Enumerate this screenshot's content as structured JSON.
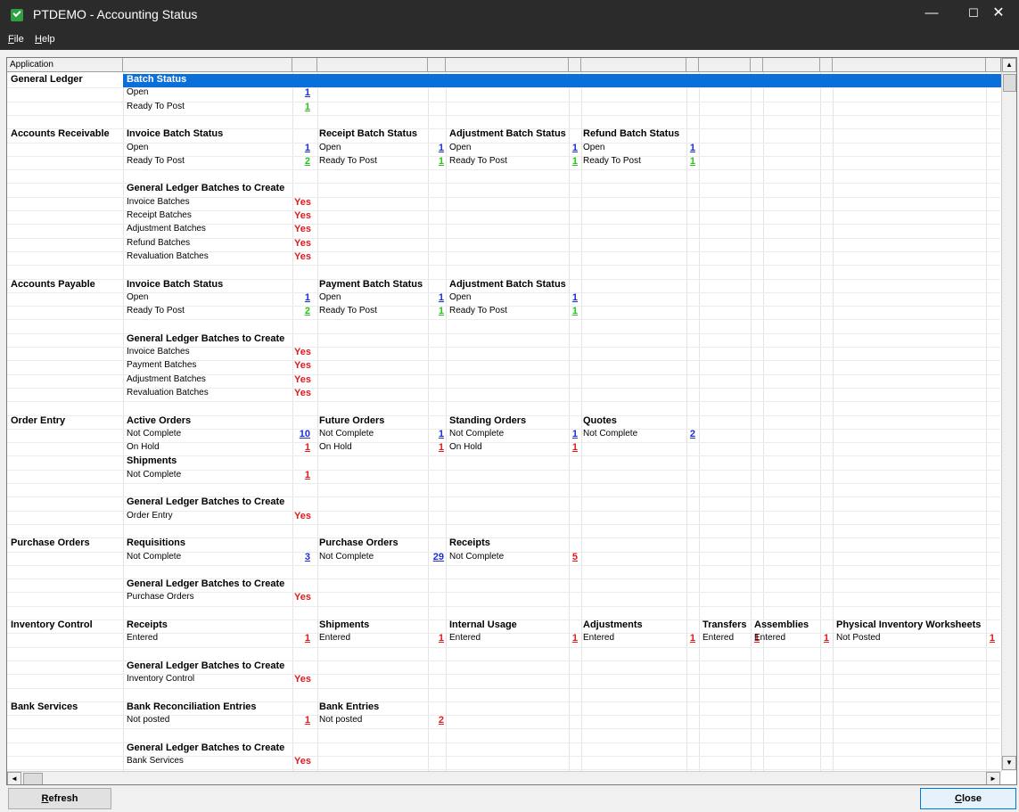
{
  "window": {
    "title": "PTDEMO - Accounting Status",
    "min": "—",
    "max": "☐",
    "close": "✕"
  },
  "menu": {
    "file_rest": "ile",
    "file_u": "F",
    "help_u": "H",
    "help_rest": "elp"
  },
  "grid": {
    "column_header": "Application",
    "selected_label": "Batch Status",
    "scroll_up": "▲",
    "scroll_down": "▼",
    "scroll_left": "◄",
    "scroll_right": "►"
  },
  "rows": [
    {
      "col": "app",
      "row": 0,
      "text": "General Ledger",
      "cls": "app"
    },
    {
      "col": "c1",
      "row": 1,
      "text": "Open",
      "cls": "txt"
    },
    {
      "col": "n1",
      "row": 1,
      "text": "1",
      "cls": "num blue"
    },
    {
      "col": "c1",
      "row": 2,
      "text": "Ready To Post",
      "cls": "txt"
    },
    {
      "col": "n1",
      "row": 2,
      "text": "1",
      "cls": "num green"
    },
    {
      "col": "app",
      "row": 4,
      "text": "Accounts Receivable",
      "cls": "app"
    },
    {
      "col": "c1",
      "row": 4,
      "text": "Invoice Batch Status",
      "cls": "hdr"
    },
    {
      "col": "c2",
      "row": 4,
      "text": "Receipt Batch Status",
      "cls": "hdr"
    },
    {
      "col": "c3",
      "row": 4,
      "text": "Adjustment Batch Status",
      "cls": "hdr"
    },
    {
      "col": "c4",
      "row": 4,
      "text": "Refund Batch Status",
      "cls": "hdr"
    },
    {
      "col": "c1",
      "row": 5,
      "text": "Open",
      "cls": "txt"
    },
    {
      "col": "n1",
      "row": 5,
      "text": "1",
      "cls": "num blue"
    },
    {
      "col": "c2",
      "row": 5,
      "text": "Open",
      "cls": "txt"
    },
    {
      "col": "n2",
      "row": 5,
      "text": "1",
      "cls": "num blue"
    },
    {
      "col": "c3",
      "row": 5,
      "text": "Open",
      "cls": "txt"
    },
    {
      "col": "n3",
      "row": 5,
      "text": "1",
      "cls": "num blue"
    },
    {
      "col": "c4",
      "row": 5,
      "text": "Open",
      "cls": "txt"
    },
    {
      "col": "n4",
      "row": 5,
      "text": "1",
      "cls": "num blue"
    },
    {
      "col": "c1",
      "row": 6,
      "text": "Ready To Post",
      "cls": "txt"
    },
    {
      "col": "n1",
      "row": 6,
      "text": "2",
      "cls": "num green"
    },
    {
      "col": "c2",
      "row": 6,
      "text": "Ready To Post",
      "cls": "txt"
    },
    {
      "col": "n2",
      "row": 6,
      "text": "1",
      "cls": "num green"
    },
    {
      "col": "c3",
      "row": 6,
      "text": "Ready To Post",
      "cls": "txt"
    },
    {
      "col": "n3",
      "row": 6,
      "text": "1",
      "cls": "num green"
    },
    {
      "col": "c4",
      "row": 6,
      "text": "Ready To Post",
      "cls": "txt"
    },
    {
      "col": "n4",
      "row": 6,
      "text": "1",
      "cls": "num green"
    },
    {
      "col": "c1",
      "row": 8,
      "text": "General Ledger Batches to Create",
      "cls": "hdr"
    },
    {
      "col": "c1",
      "row": 9,
      "text": "Invoice Batches",
      "cls": "txt"
    },
    {
      "col": "y1",
      "row": 9,
      "text": "Yes",
      "cls": "yes"
    },
    {
      "col": "c1",
      "row": 10,
      "text": "Receipt Batches",
      "cls": "txt"
    },
    {
      "col": "y1",
      "row": 10,
      "text": "Yes",
      "cls": "yes"
    },
    {
      "col": "c1",
      "row": 11,
      "text": "Adjustment Batches",
      "cls": "txt"
    },
    {
      "col": "y1",
      "row": 11,
      "text": "Yes",
      "cls": "yes"
    },
    {
      "col": "c1",
      "row": 12,
      "text": "Refund Batches",
      "cls": "txt"
    },
    {
      "col": "y1",
      "row": 12,
      "text": "Yes",
      "cls": "yes"
    },
    {
      "col": "c1",
      "row": 13,
      "text": "Revaluation Batches",
      "cls": "txt"
    },
    {
      "col": "y1",
      "row": 13,
      "text": "Yes",
      "cls": "yes"
    },
    {
      "col": "app",
      "row": 15,
      "text": "Accounts Payable",
      "cls": "app"
    },
    {
      "col": "c1",
      "row": 15,
      "text": "Invoice Batch Status",
      "cls": "hdr"
    },
    {
      "col": "c2",
      "row": 15,
      "text": "Payment Batch Status",
      "cls": "hdr"
    },
    {
      "col": "c3",
      "row": 15,
      "text": "Adjustment Batch Status",
      "cls": "hdr"
    },
    {
      "col": "c1",
      "row": 16,
      "text": "Open",
      "cls": "txt"
    },
    {
      "col": "n1",
      "row": 16,
      "text": "1",
      "cls": "num blue"
    },
    {
      "col": "c2",
      "row": 16,
      "text": "Open",
      "cls": "txt"
    },
    {
      "col": "n2",
      "row": 16,
      "text": "1",
      "cls": "num blue"
    },
    {
      "col": "c3",
      "row": 16,
      "text": "Open",
      "cls": "txt"
    },
    {
      "col": "n3",
      "row": 16,
      "text": "1",
      "cls": "num blue"
    },
    {
      "col": "c1",
      "row": 17,
      "text": "Ready To Post",
      "cls": "txt"
    },
    {
      "col": "n1",
      "row": 17,
      "text": "2",
      "cls": "num green"
    },
    {
      "col": "c2",
      "row": 17,
      "text": "Ready To Post",
      "cls": "txt"
    },
    {
      "col": "n2",
      "row": 17,
      "text": "1",
      "cls": "num green"
    },
    {
      "col": "c3",
      "row": 17,
      "text": "Ready To Post",
      "cls": "txt"
    },
    {
      "col": "n3",
      "row": 17,
      "text": "1",
      "cls": "num green"
    },
    {
      "col": "c1",
      "row": 19,
      "text": "General Ledger Batches to Create",
      "cls": "hdr"
    },
    {
      "col": "c1",
      "row": 20,
      "text": "Invoice Batches",
      "cls": "txt"
    },
    {
      "col": "y1",
      "row": 20,
      "text": "Yes",
      "cls": "yes"
    },
    {
      "col": "c1",
      "row": 21,
      "text": "Payment Batches",
      "cls": "txt"
    },
    {
      "col": "y1",
      "row": 21,
      "text": "Yes",
      "cls": "yes"
    },
    {
      "col": "c1",
      "row": 22,
      "text": "Adjustment Batches",
      "cls": "txt"
    },
    {
      "col": "y1",
      "row": 22,
      "text": "Yes",
      "cls": "yes"
    },
    {
      "col": "c1",
      "row": 23,
      "text": "Revaluation Batches",
      "cls": "txt"
    },
    {
      "col": "y1",
      "row": 23,
      "text": "Yes",
      "cls": "yes"
    },
    {
      "col": "app",
      "row": 25,
      "text": "Order Entry",
      "cls": "app"
    },
    {
      "col": "c1",
      "row": 25,
      "text": "Active Orders",
      "cls": "hdr"
    },
    {
      "col": "c2",
      "row": 25,
      "text": "Future Orders",
      "cls": "hdr"
    },
    {
      "col": "c3",
      "row": 25,
      "text": "Standing Orders",
      "cls": "hdr"
    },
    {
      "col": "c4",
      "row": 25,
      "text": "Quotes",
      "cls": "hdr"
    },
    {
      "col": "c1",
      "row": 26,
      "text": "Not Complete",
      "cls": "txt"
    },
    {
      "col": "n1",
      "row": 26,
      "text": "10",
      "cls": "num blue"
    },
    {
      "col": "c2",
      "row": 26,
      "text": "Not Complete",
      "cls": "txt"
    },
    {
      "col": "n2",
      "row": 26,
      "text": "1",
      "cls": "num blue"
    },
    {
      "col": "c3",
      "row": 26,
      "text": "Not Complete",
      "cls": "txt"
    },
    {
      "col": "n3",
      "row": 26,
      "text": "1",
      "cls": "num blue"
    },
    {
      "col": "c4",
      "row": 26,
      "text": "Not Complete",
      "cls": "txt"
    },
    {
      "col": "n4",
      "row": 26,
      "text": "2",
      "cls": "num blue"
    },
    {
      "col": "c1",
      "row": 27,
      "text": "On Hold",
      "cls": "txt"
    },
    {
      "col": "n1",
      "row": 27,
      "text": "1",
      "cls": "num red"
    },
    {
      "col": "c2",
      "row": 27,
      "text": "On Hold",
      "cls": "txt"
    },
    {
      "col": "n2",
      "row": 27,
      "text": "1",
      "cls": "num red"
    },
    {
      "col": "c3",
      "row": 27,
      "text": "On Hold",
      "cls": "txt"
    },
    {
      "col": "n3",
      "row": 27,
      "text": "1",
      "cls": "num red"
    },
    {
      "col": "c1",
      "row": 28,
      "text": "Shipments",
      "cls": "hdr"
    },
    {
      "col": "c1",
      "row": 29,
      "text": "Not Complete",
      "cls": "txt"
    },
    {
      "col": "n1",
      "row": 29,
      "text": "1",
      "cls": "num red"
    },
    {
      "col": "c1",
      "row": 31,
      "text": "General Ledger Batches to Create",
      "cls": "hdr"
    },
    {
      "col": "c1",
      "row": 32,
      "text": "Order Entry",
      "cls": "txt"
    },
    {
      "col": "y1",
      "row": 32,
      "text": "Yes",
      "cls": "yes"
    },
    {
      "col": "app",
      "row": 34,
      "text": "Purchase Orders",
      "cls": "app"
    },
    {
      "col": "c1",
      "row": 34,
      "text": "Requisitions",
      "cls": "hdr"
    },
    {
      "col": "c2",
      "row": 34,
      "text": "Purchase Orders",
      "cls": "hdr"
    },
    {
      "col": "c3",
      "row": 34,
      "text": "Receipts",
      "cls": "hdr"
    },
    {
      "col": "c1",
      "row": 35,
      "text": "Not Complete",
      "cls": "txt"
    },
    {
      "col": "n1",
      "row": 35,
      "text": "3",
      "cls": "num blue"
    },
    {
      "col": "c2",
      "row": 35,
      "text": "Not Complete",
      "cls": "txt"
    },
    {
      "col": "n2",
      "row": 35,
      "text": "29",
      "cls": "num blue"
    },
    {
      "col": "c3",
      "row": 35,
      "text": "Not Complete",
      "cls": "txt"
    },
    {
      "col": "n3",
      "row": 35,
      "text": "5",
      "cls": "num red"
    },
    {
      "col": "c1",
      "row": 37,
      "text": "General Ledger Batches to Create",
      "cls": "hdr"
    },
    {
      "col": "c1",
      "row": 38,
      "text": "Purchase Orders",
      "cls": "txt"
    },
    {
      "col": "y1",
      "row": 38,
      "text": "Yes",
      "cls": "yes"
    },
    {
      "col": "app",
      "row": 40,
      "text": "Inventory Control",
      "cls": "app"
    },
    {
      "col": "c1",
      "row": 40,
      "text": "Receipts",
      "cls": "hdr"
    },
    {
      "col": "c2",
      "row": 40,
      "text": "Shipments",
      "cls": "hdr"
    },
    {
      "col": "c3",
      "row": 40,
      "text": "Internal Usage",
      "cls": "hdr"
    },
    {
      "col": "c4",
      "row": 40,
      "text": "Adjustments",
      "cls": "hdr"
    },
    {
      "col": "c5",
      "row": 40,
      "text": "Transfers",
      "cls": "hdr"
    },
    {
      "col": "c6",
      "row": 40,
      "text": "Assemblies",
      "cls": "hdr"
    },
    {
      "col": "c7",
      "row": 40,
      "text": "Physical Inventory Worksheets",
      "cls": "hdr"
    },
    {
      "col": "c1",
      "row": 41,
      "text": "Entered",
      "cls": "txt"
    },
    {
      "col": "n1",
      "row": 41,
      "text": "1",
      "cls": "num red"
    },
    {
      "col": "c2",
      "row": 41,
      "text": "Entered",
      "cls": "txt"
    },
    {
      "col": "n2",
      "row": 41,
      "text": "1",
      "cls": "num red"
    },
    {
      "col": "c3",
      "row": 41,
      "text": "Entered",
      "cls": "txt"
    },
    {
      "col": "n3",
      "row": 41,
      "text": "1",
      "cls": "num red"
    },
    {
      "col": "c4",
      "row": 41,
      "text": "Entered",
      "cls": "txt"
    },
    {
      "col": "n4",
      "row": 41,
      "text": "1",
      "cls": "num red"
    },
    {
      "col": "c5",
      "row": 41,
      "text": "Entered",
      "cls": "txt"
    },
    {
      "col": "n5",
      "row": 41,
      "text": "1",
      "cls": "num red"
    },
    {
      "col": "c6",
      "row": 41,
      "text": "Entered",
      "cls": "txt"
    },
    {
      "col": "n6",
      "row": 41,
      "text": "1",
      "cls": "num red"
    },
    {
      "col": "c7",
      "row": 41,
      "text": "Not Posted",
      "cls": "txt"
    },
    {
      "col": "n7",
      "row": 41,
      "text": "1",
      "cls": "num red"
    },
    {
      "col": "c1",
      "row": 43,
      "text": "General Ledger Batches to Create",
      "cls": "hdr"
    },
    {
      "col": "c1",
      "row": 44,
      "text": "Inventory Control",
      "cls": "txt"
    },
    {
      "col": "y1",
      "row": 44,
      "text": "Yes",
      "cls": "yes"
    },
    {
      "col": "app",
      "row": 46,
      "text": "Bank Services",
      "cls": "app"
    },
    {
      "col": "c1",
      "row": 46,
      "text": "Bank Reconciliation Entries",
      "cls": "hdr"
    },
    {
      "col": "c2",
      "row": 46,
      "text": "Bank Entries",
      "cls": "hdr"
    },
    {
      "col": "c1",
      "row": 47,
      "text": "Not posted",
      "cls": "txt"
    },
    {
      "col": "n1",
      "row": 47,
      "text": "1",
      "cls": "num red"
    },
    {
      "col": "c2",
      "row": 47,
      "text": "Not posted",
      "cls": "txt"
    },
    {
      "col": "n2",
      "row": 47,
      "text": "2",
      "cls": "num red"
    },
    {
      "col": "c1",
      "row": 49,
      "text": "General Ledger Batches to Create",
      "cls": "hdr"
    },
    {
      "col": "c1",
      "row": 50,
      "text": "Bank Services",
      "cls": "txt"
    },
    {
      "col": "y1",
      "row": 50,
      "text": "Yes",
      "cls": "yes"
    }
  ],
  "buttons": {
    "refresh_u": "R",
    "refresh_rest": "efresh",
    "close_u": "C",
    "close_rest": "lose"
  },
  "colors": {
    "titlebar": "#2b2b2b",
    "selection": "#0a6fd8",
    "link_blue": "#1a2fd6",
    "ready_green": "#27c41e",
    "alert_red": "#e01b1b"
  }
}
